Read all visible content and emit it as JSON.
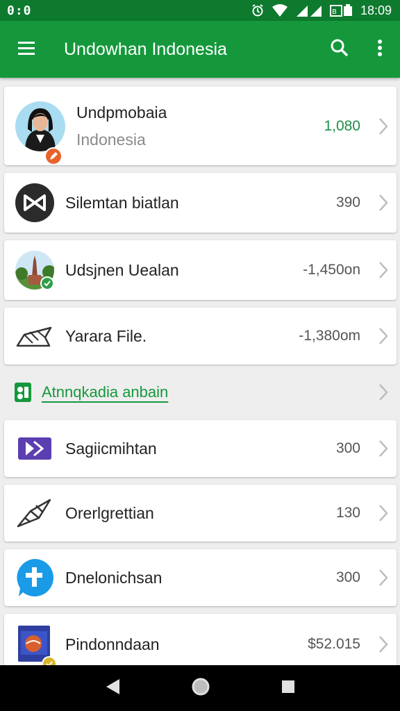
{
  "status_bar": {
    "left_text": "0:0",
    "time": "18:09"
  },
  "app_bar": {
    "title": "Undowhan Indonesia"
  },
  "profile": {
    "title": "Undpmobaia",
    "subtitle": "Indonesia",
    "value": "1,080"
  },
  "rows": [
    {
      "label": "Silemtan biatlan",
      "value": "390"
    },
    {
      "label": "Udsjnen Uealan",
      "value": "-1,450on"
    },
    {
      "label": "Yarara File.",
      "value": "-1,380om"
    }
  ],
  "section": {
    "label": "Atnnqkadia anbain"
  },
  "rows2": [
    {
      "label": "Sagiicmihtan",
      "value": "300"
    },
    {
      "label": "Orerlgrettian",
      "value": "130"
    },
    {
      "label": "Dnelonichsan",
      "value": "300"
    },
    {
      "label": "Pindonndaan",
      "value": "$52.015"
    }
  ],
  "colors": {
    "status_bar": "#0d7a2e",
    "app_bar": "#15983c",
    "accent_green": "#1e8e48",
    "badge_orange": "#e8632b",
    "icon_purple": "#5b3fb0",
    "icon_blue": "#1a9be8"
  },
  "icons": {
    "menu": "menu-icon",
    "search": "search-icon",
    "more": "more-vert-icon",
    "back": "back-triangle-icon",
    "home": "home-circle-icon",
    "recents": "recents-square-icon"
  }
}
